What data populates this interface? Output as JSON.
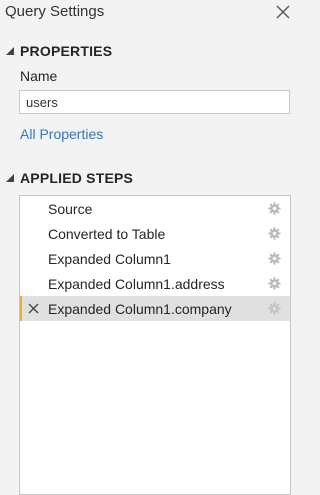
{
  "panel": {
    "title": "Query Settings",
    "close_icon": "close-icon"
  },
  "properties": {
    "header": "PROPERTIES",
    "name_label": "Name",
    "name_value": "users",
    "all_properties_link": "All Properties"
  },
  "applied_steps": {
    "header": "APPLIED STEPS",
    "steps": [
      {
        "label": "Source",
        "selected": false
      },
      {
        "label": "Converted to Table",
        "selected": false
      },
      {
        "label": "Expanded Column1",
        "selected": false
      },
      {
        "label": "Expanded Column1.address",
        "selected": false
      },
      {
        "label": "Expanded Column1.company",
        "selected": true
      }
    ]
  },
  "colors": {
    "background": "#f3f3f3",
    "link": "#2b79c2",
    "selected_row": "#e0e0e0",
    "selected_marker": "#e3b535",
    "gear": "#b8b8b8"
  }
}
